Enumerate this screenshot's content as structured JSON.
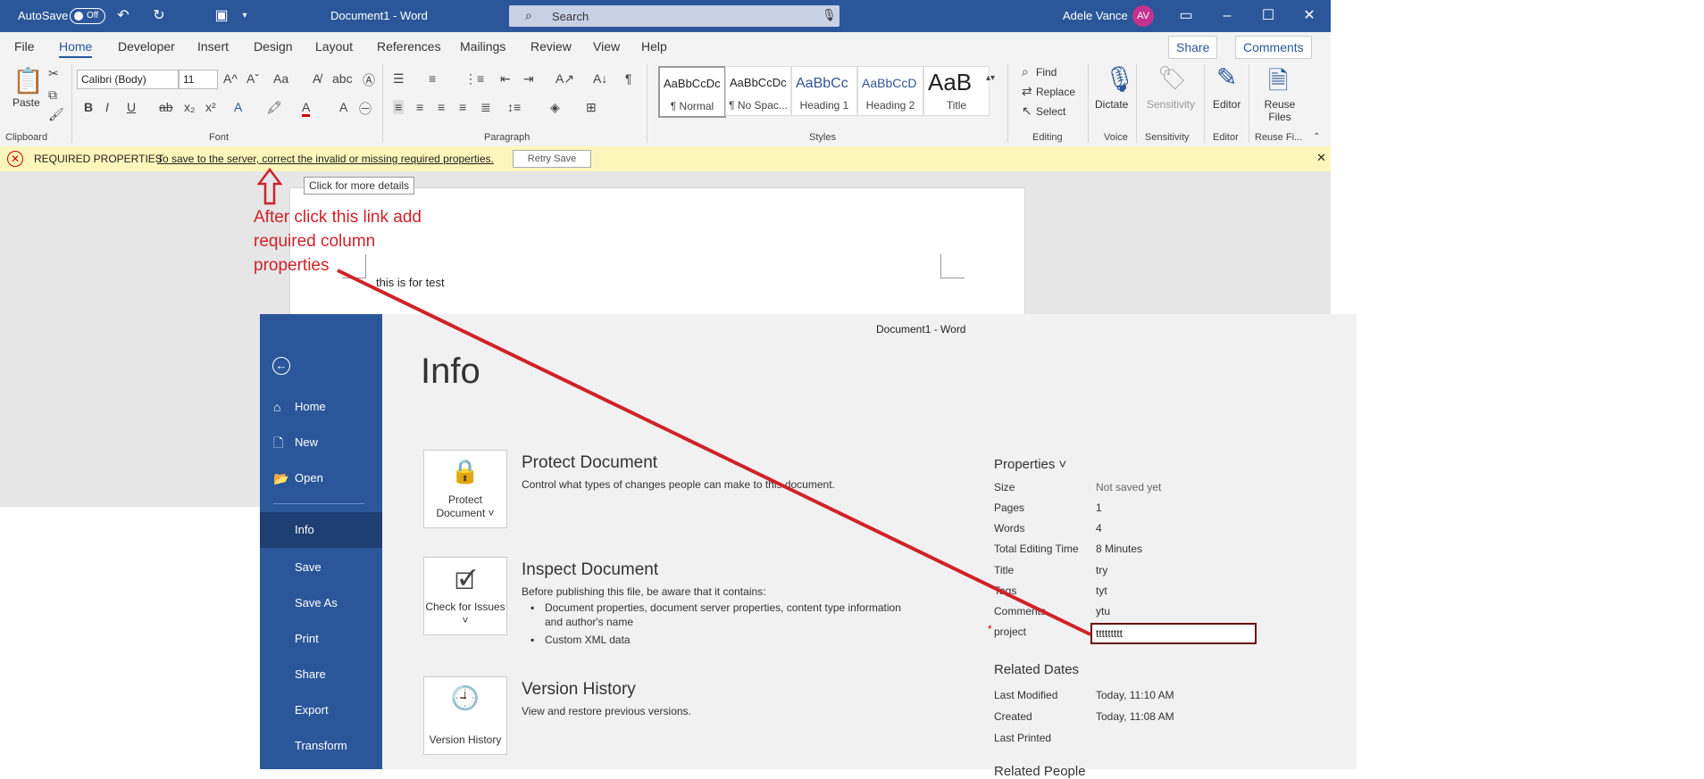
{
  "titlebar": {
    "autosave_label": "AutoSave",
    "autosave_state": "Off",
    "doc_title": "Document1  -  Word",
    "search_placeholder": "Search",
    "user_name": "Adele Vance",
    "user_initials": "AV"
  },
  "menu": {
    "tabs": [
      "File",
      "Home",
      "Developer",
      "Insert",
      "Design",
      "Layout",
      "References",
      "Mailings",
      "Review",
      "View",
      "Help"
    ],
    "active": "Home",
    "share_label": "Share",
    "comments_label": "Comments"
  },
  "ribbon": {
    "paste_label": "Paste",
    "font_name": "Calibri (Body)",
    "font_size": "11",
    "styles": [
      {
        "sample": "AaBbCcDc",
        "name": "¶ Normal"
      },
      {
        "sample": "AaBbCcDc",
        "name": "¶ No Spac..."
      },
      {
        "sample": "AaBbCc",
        "name": "Heading 1"
      },
      {
        "sample": "AaBbCcD",
        "name": "Heading 2"
      },
      {
        "sample": "AaB",
        "name": "Title"
      }
    ],
    "find_label": "Find",
    "replace_label": "Replace",
    "select_label": "Select",
    "dictate_label": "Dictate",
    "sensitivity_label": "Sensitivity",
    "editor_label": "Editor",
    "reuse_label": "Reuse Files",
    "groups": {
      "clipboard": "Clipboard",
      "font": "Font",
      "paragraph": "Paragraph",
      "styles": "Styles",
      "editing": "Editing",
      "voice": "Voice",
      "sensitivity": "Sensitivity",
      "editor": "Editor",
      "reuse": "Reuse Fi..."
    }
  },
  "notification": {
    "title": "REQUIRED PROPERTIES",
    "link": "To save to the server, correct the invalid or missing required properties.",
    "retry_label": "Retry Save",
    "tooltip": "Click for more details"
  },
  "document": {
    "body_text": "this is for test"
  },
  "annotation": {
    "line1": "After click this link add",
    "line2": "required column",
    "line3": "properties"
  },
  "backstage": {
    "window_title": "Document1  -  Word",
    "heading": "Info",
    "nav": [
      {
        "label": "Home",
        "icon": "home-icon"
      },
      {
        "label": "New",
        "icon": "new-icon"
      },
      {
        "label": "Open",
        "icon": "open-icon"
      },
      {
        "label": "Info",
        "icon": ""
      },
      {
        "label": "Save",
        "icon": ""
      },
      {
        "label": "Save As",
        "icon": ""
      },
      {
        "label": "Print",
        "icon": ""
      },
      {
        "label": "Share",
        "icon": ""
      },
      {
        "label": "Export",
        "icon": ""
      },
      {
        "label": "Transform",
        "icon": ""
      }
    ],
    "protect": {
      "button": "Protect Document ˅",
      "title": "Protect Document",
      "desc": "Control what types of changes people can make to this document."
    },
    "inspect": {
      "button": "Check for Issues ˅",
      "title": "Inspect Document",
      "desc": "Before publishing this file, be aware that it contains:",
      "bullets": [
        "Document properties, document server properties, content type information",
        "and author's name",
        "Custom XML data"
      ]
    },
    "version": {
      "button": "Version History",
      "title": "Version History",
      "desc": "View and restore previous versions."
    },
    "properties": {
      "heading": "Properties ˅",
      "rows": [
        {
          "k": "Size",
          "v": "Not saved yet"
        },
        {
          "k": "Pages",
          "v": "1"
        },
        {
          "k": "Words",
          "v": "4"
        },
        {
          "k": "Total Editing Time",
          "v": "8 Minutes"
        },
        {
          "k": "Title",
          "v": "try"
        },
        {
          "k": "Tags",
          "v": "tyt"
        },
        {
          "k": "Comments",
          "v": "ytu"
        }
      ],
      "required_marker": "*",
      "project_label": "project",
      "project_value": "ttttttttt"
    },
    "related_dates": {
      "heading": "Related Dates",
      "rows": [
        {
          "k": "Last Modified",
          "v": "Today, 11:10 AM"
        },
        {
          "k": "Created",
          "v": "Today, 11:08 AM"
        },
        {
          "k": "Last Printed",
          "v": ""
        }
      ]
    },
    "related_people_heading": "Related People"
  },
  "colors": {
    "word_blue": "#2b579a",
    "annotation_red": "#d0222a",
    "notif_yellow": "#fdf6bb"
  }
}
